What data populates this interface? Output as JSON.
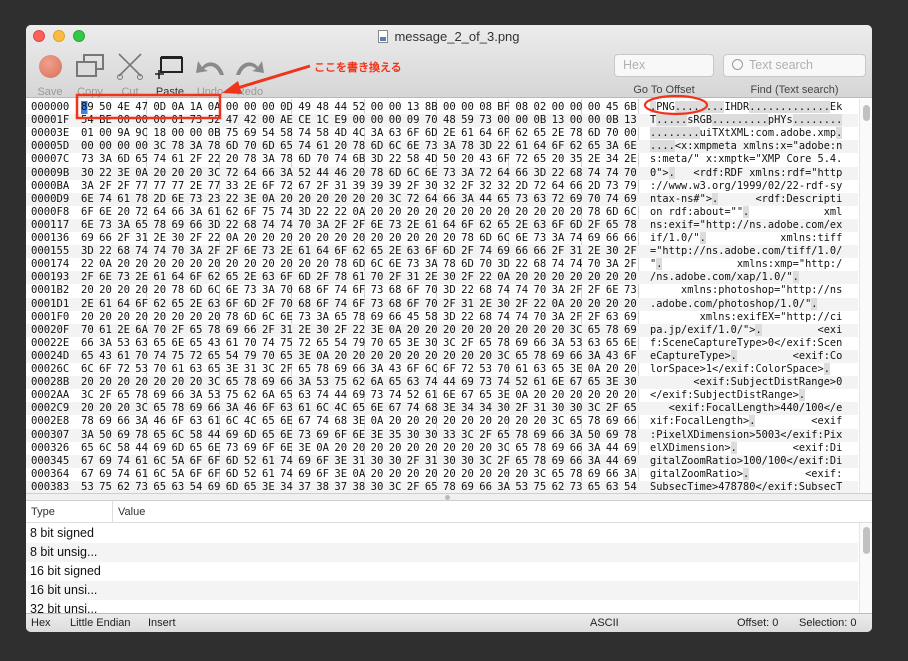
{
  "window": {
    "title": "message_2_of_3.png",
    "file_icon": "png-file-icon"
  },
  "toolbar": {
    "save": "Save",
    "copy": "Copy",
    "cut": "Cut",
    "paste": "Paste",
    "undo": "Undo",
    "redo": "Redo",
    "goto_placeholder": "Hex",
    "goto_label": "Go To Offset",
    "search_placeholder": "Text search",
    "search_label": "Find (Text search)"
  },
  "annotation": {
    "label": "ここを書き換える",
    "color": "#f0341c"
  },
  "hex_rows": [
    {
      "offset": "000000",
      "bytes": "89 50 4E 47 0D 0A 1A 0A 00 00 00 0D 49 48 44 52 00 00 13 8B 00 00 08 BF 08 02 00 00 00 45 6B"
    },
    {
      "offset": "00001F",
      "bytes": "54 BE 00 00 00 01 73 52 47 42 00 AE CE 1C E9 00 00 00 09 70 48 59 73 00 00 0B 13 00 00 0B 13"
    },
    {
      "offset": "00003E",
      "bytes": "01 00 9A 9C 18 00 00 0B 75 69 54 58 74 58 4D 4C 3A 63 6F 6D 2E 61 64 6F 62 65 2E 78 6D 70 00"
    },
    {
      "offset": "00005D",
      "bytes": "00 00 00 00 3C 78 3A 78 6D 70 6D 65 74 61 20 78 6D 6C 6E 73 3A 78 3D 22 61 64 6F 62 65 3A 6E"
    },
    {
      "offset": "00007C",
      "bytes": "73 3A 6D 65 74 61 2F 22 20 78 3A 78 6D 70 74 6B 3D 22 58 4D 50 20 43 6F 72 65 20 35 2E 34 2E"
    },
    {
      "offset": "00009B",
      "bytes": "30 22 3E 0A 20 20 20 3C 72 64 66 3A 52 44 46 20 78 6D 6C 6E 73 3A 72 64 66 3D 22 68 74 74 70"
    },
    {
      "offset": "0000BA",
      "bytes": "3A 2F 2F 77 77 77 2E 77 33 2E 6F 72 67 2F 31 39 39 39 2F 30 32 2F 32 32 2D 72 64 66 2D 73 79"
    },
    {
      "offset": "0000D9",
      "bytes": "6E 74 61 78 2D 6E 73 23 22 3E 0A 20 20 20 20 20 20 3C 72 64 66 3A 44 65 73 63 72 69 70 74 69"
    },
    {
      "offset": "0000F8",
      "bytes": "6F 6E 20 72 64 66 3A 61 62 6F 75 74 3D 22 22 0A 20 20 20 20 20 20 20 20 20 20 20 20 78 6D 6C"
    },
    {
      "offset": "000117",
      "bytes": "6E 73 3A 65 78 69 66 3D 22 68 74 74 70 3A 2F 2F 6E 73 2E 61 64 6F 62 65 2E 63 6F 6D 2F 65 78"
    },
    {
      "offset": "000136",
      "bytes": "69 66 2F 31 2E 30 2F 22 0A 20 20 20 20 20 20 20 20 20 20 20 20 78 6D 6C 6E 73 3A 74 69 66 66"
    },
    {
      "offset": "000155",
      "bytes": "3D 22 68 74 74 70 3A 2F 2F 6E 73 2E 61 64 6F 62 65 2E 63 6F 6D 2F 74 69 66 66 2F 31 2E 30 2F"
    },
    {
      "offset": "000174",
      "bytes": "22 0A 20 20 20 20 20 20 20 20 20 20 20 20 78 6D 6C 6E 73 3A 78 6D 70 3D 22 68 74 74 70 3A 2F"
    },
    {
      "offset": "000193",
      "bytes": "2F 6E 73 2E 61 64 6F 62 65 2E 63 6F 6D 2F 78 61 70 2F 31 2E 30 2F 22 0A 20 20 20 20 20 20 20"
    },
    {
      "offset": "0001B2",
      "bytes": "20 20 20 20 20 78 6D 6C 6E 73 3A 70 68 6F 74 6F 73 68 6F 70 3D 22 68 74 74 70 3A 2F 2F 6E 73"
    },
    {
      "offset": "0001D1",
      "bytes": "2E 61 64 6F 62 65 2E 63 6F 6D 2F 70 68 6F 74 6F 73 68 6F 70 2F 31 2E 30 2F 22 0A 20 20 20 20"
    },
    {
      "offset": "0001F0",
      "bytes": "20 20 20 20 20 20 20 20 78 6D 6C 6E 73 3A 65 78 69 66 45 58 3D 22 68 74 74 70 3A 2F 2F 63 69"
    },
    {
      "offset": "00020F",
      "bytes": "70 61 2E 6A 70 2F 65 78 69 66 2F 31 2E 30 2F 22 3E 0A 20 20 20 20 20 20 20 20 20 3C 65 78 69"
    },
    {
      "offset": "00022E",
      "bytes": "66 3A 53 63 65 6E 65 43 61 70 74 75 72 65 54 79 70 65 3E 30 3C 2F 65 78 69 66 3A 53 63 65 6E"
    },
    {
      "offset": "00024D",
      "bytes": "65 43 61 70 74 75 72 65 54 79 70 65 3E 0A 20 20 20 20 20 20 20 20 20 3C 65 78 69 66 3A 43 6F"
    },
    {
      "offset": "00026C",
      "bytes": "6C 6F 72 53 70 61 63 65 3E 31 3C 2F 65 78 69 66 3A 43 6F 6C 6F 72 53 70 61 63 65 3E 0A 20 20"
    },
    {
      "offset": "00028B",
      "bytes": "20 20 20 20 20 20 20 3C 65 78 69 66 3A 53 75 62 6A 65 63 74 44 69 73 74 52 61 6E 67 65 3E 30"
    },
    {
      "offset": "0002AA",
      "bytes": "3C 2F 65 78 69 66 3A 53 75 62 6A 65 63 74 44 69 73 74 52 61 6E 67 65 3E 0A 20 20 20 20 20 20"
    },
    {
      "offset": "0002C9",
      "bytes": "20 20 20 3C 65 78 69 66 3A 46 6F 63 61 6C 4C 65 6E 67 74 68 3E 34 34 30 2F 31 30 30 3C 2F 65"
    },
    {
      "offset": "0002E8",
      "bytes": "78 69 66 3A 46 6F 63 61 6C 4C 65 6E 67 74 68 3E 0A 20 20 20 20 20 20 20 20 20 3C 65 78 69 66"
    },
    {
      "offset": "000307",
      "bytes": "3A 50 69 78 65 6C 58 44 69 6D 65 6E 73 69 6F 6E 3E 35 30 30 33 3C 2F 65 78 69 66 3A 50 69 78"
    },
    {
      "offset": "000326",
      "bytes": "65 6C 58 44 69 6D 65 6E 73 69 6F 6E 3E 0A 20 20 20 20 20 20 20 20 20 3C 65 78 69 66 3A 44 69"
    },
    {
      "offset": "000345",
      "bytes": "67 69 74 61 6C 5A 6F 6F 6D 52 61 74 69 6F 3E 31 30 30 2F 31 30 30 3C 2F 65 78 69 66 3A 44 69"
    },
    {
      "offset": "000364",
      "bytes": "67 69 74 61 6C 5A 6F 6F 6D 52 61 74 69 6F 3E 0A 20 20 20 20 20 20 20 20 20 3C 65 78 69 66 3A"
    },
    {
      "offset": "000383",
      "bytes": "53 75 62 73 65 63 54 69 6D 65 3E 34 37 38 37 38 30 3C 2F 65 78 69 66 3A 53 75 62 73 65 63 54"
    }
  ],
  "inspector": {
    "headers": {
      "type": "Type",
      "value": "Value"
    },
    "rows": [
      {
        "type": "8 bit signed",
        "value": ""
      },
      {
        "type": "8 bit unsig...",
        "value": ""
      },
      {
        "type": "16 bit signed",
        "value": ""
      },
      {
        "type": "16 bit unsi...",
        "value": ""
      },
      {
        "type": "32 bit unsi...",
        "value": ""
      }
    ]
  },
  "status": {
    "mode": "Hex",
    "endian": "Little Endian",
    "insert": "Insert",
    "encoding": "ASCII",
    "offset": "Offset: 0",
    "selection": "Selection: 0"
  }
}
